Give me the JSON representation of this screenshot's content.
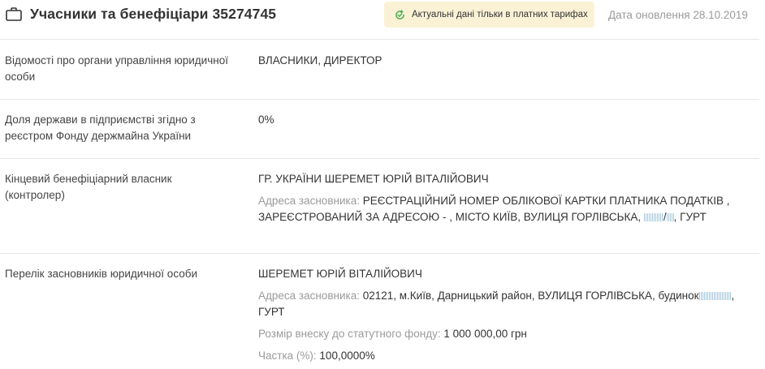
{
  "header": {
    "title": "Учасники та бенефіціари 35274745",
    "badge_text": "Актуальні дані тільки в платних тарифах",
    "updated": "Дата оновлення 28.10.2019",
    "accent_color": "#4caf50",
    "badge_bg": "#fbf2d6"
  },
  "rows": {
    "governance": {
      "label": "Відомості про органи управління юридичної особи",
      "value": "ВЛАСНИКИ, ДИРЕКТОР"
    },
    "state_share": {
      "label": "Доля держави в підприємстві згідно з реєстром Фонду держмайна України",
      "value": "0%"
    },
    "beneficiary": {
      "label": "Кінцевий бенефіціарний власник (контролер)",
      "name": "ГР. УКРАЇНИ ШЕРЕМЕТ ЮРІЙ ВІТАЛІЙОВИЧ",
      "address_label": "Адреса засновника:",
      "address_part1": "РЕЄСТРАЦІЙНИЙ НОМЕР ОБЛІКОВОЇ КАРТКИ ПЛАТНИКА ПОДАТКІВ , ЗАРЕЄСТРОВАНИЙ ЗА АДРЕСОЮ - , МІСТО КИЇВ, ВУЛИЦЯ ГОРЛІВСЬКА, ",
      "address_sep": "/",
      "address_part2": ", ГУРТ"
    },
    "founders": {
      "label": "Перелік засновників юридичної особи",
      "name": "ШЕРЕМЕТ ЮРІЙ ВІТАЛІЙОВИЧ",
      "address_label": "Адреса засновника:",
      "address_part1": "02121, м.Київ, Дарницький район, ВУЛИЦЯ ГОРЛІВСЬКА, будинок",
      "address_part2": ", ГУРТ",
      "capital_label": "Розмір внеску до статутного фонду:",
      "capital_value": "1 000 000,00 грн",
      "share_label": "Частка (%):",
      "share_value": "100,0000%"
    }
  }
}
